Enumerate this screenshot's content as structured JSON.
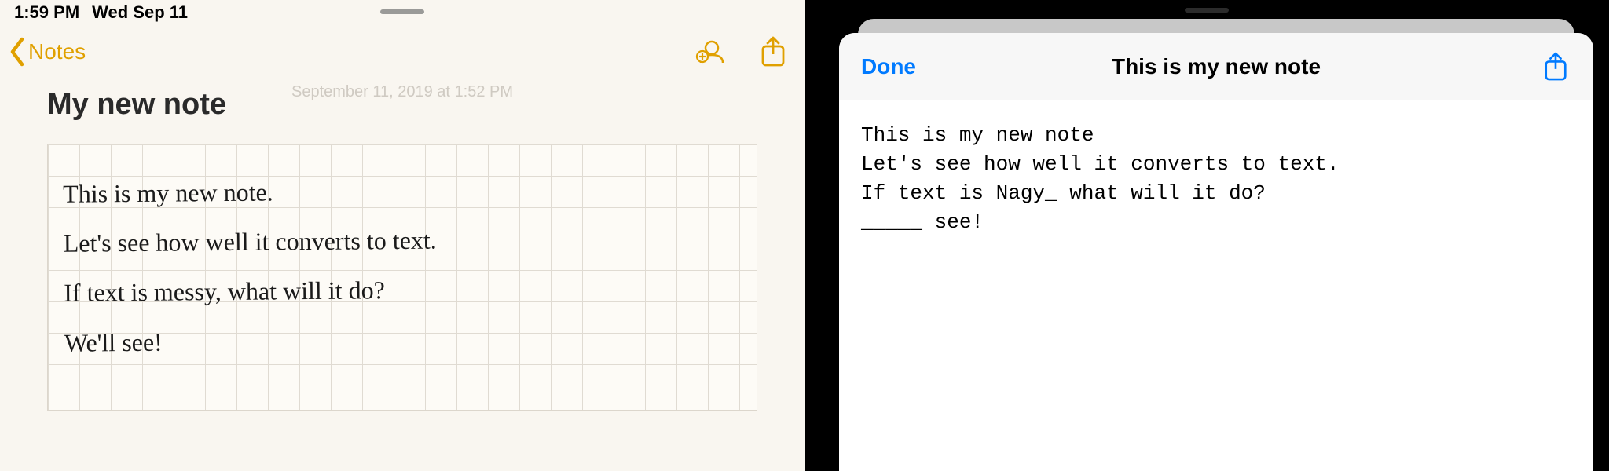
{
  "left": {
    "status": {
      "time": "1:59 PM",
      "date": "Wed Sep 11"
    },
    "nav": {
      "back_label": "Notes"
    },
    "ghost_date": "September 11, 2019 at 1:52 PM",
    "title": "My new note",
    "handwriting": {
      "line1": "This is my new note.",
      "line2": "Let's see how well it converts to text.",
      "line3": "If text is messy, what will it do?",
      "line4": "We'll see!"
    }
  },
  "right": {
    "nav": {
      "done_label": "Done",
      "title": "This is my new note"
    },
    "body": "This is my new note\nLet's see how well it converts to text.\nIf text is Nagy_ what will it do?\n_____ see!"
  }
}
